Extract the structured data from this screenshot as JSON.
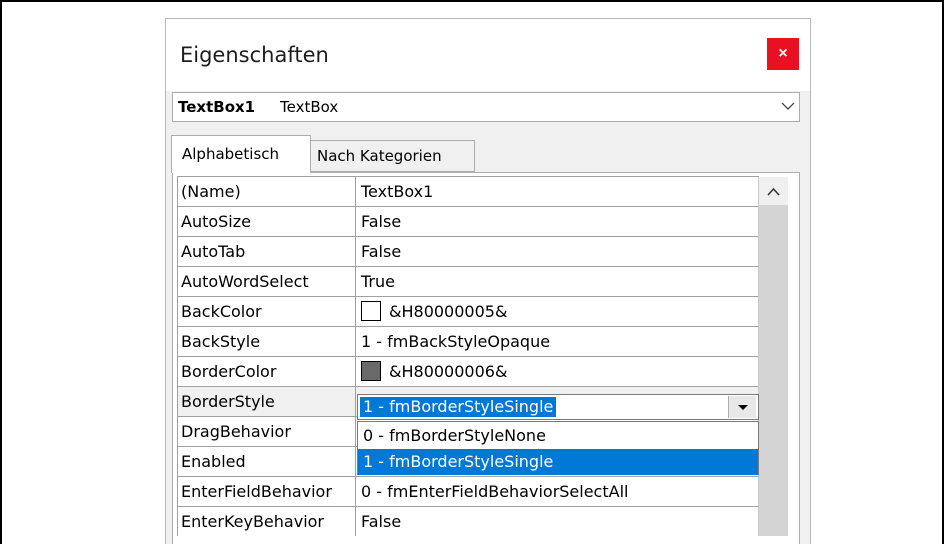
{
  "window": {
    "title": "Eigenschaften",
    "close_label": "×"
  },
  "object_selector": {
    "name": "TextBox1",
    "type": "TextBox"
  },
  "tabs": [
    {
      "label": "Alphabetisch",
      "active": true
    },
    {
      "label": "Nach Kategorien",
      "active": false
    }
  ],
  "properties": [
    {
      "name": "(Name)",
      "value": "TextBox1"
    },
    {
      "name": "AutoSize",
      "value": "False"
    },
    {
      "name": "AutoTab",
      "value": "False"
    },
    {
      "name": "AutoWordSelect",
      "value": "True"
    },
    {
      "name": "BackColor",
      "value": "&H80000005&",
      "swatch": "#ffffff"
    },
    {
      "name": "BackStyle",
      "value": "1 - fmBackStyleOpaque"
    },
    {
      "name": "BorderColor",
      "value": "&H80000006&",
      "swatch": "#696969"
    },
    {
      "name": "BorderStyle",
      "value": "1 - fmBorderStyleSingle"
    },
    {
      "name": "DragBehavior",
      "value": ""
    },
    {
      "name": "Enabled",
      "value": ""
    },
    {
      "name": "EnterFieldBehavior",
      "value": "0 - fmEnterFieldBehaviorSelectAll"
    },
    {
      "name": "EnterKeyBehavior",
      "value": "False"
    }
  ],
  "editor": {
    "value": "1 - fmBorderStyleSingle",
    "options": [
      "0 - fmBorderStyleNone",
      "1 - fmBorderStyleSingle"
    ],
    "selected_option": "1 - fmBorderStyleSingle"
  },
  "colors": {
    "accent": "#0078d7",
    "close": "#e81123"
  }
}
